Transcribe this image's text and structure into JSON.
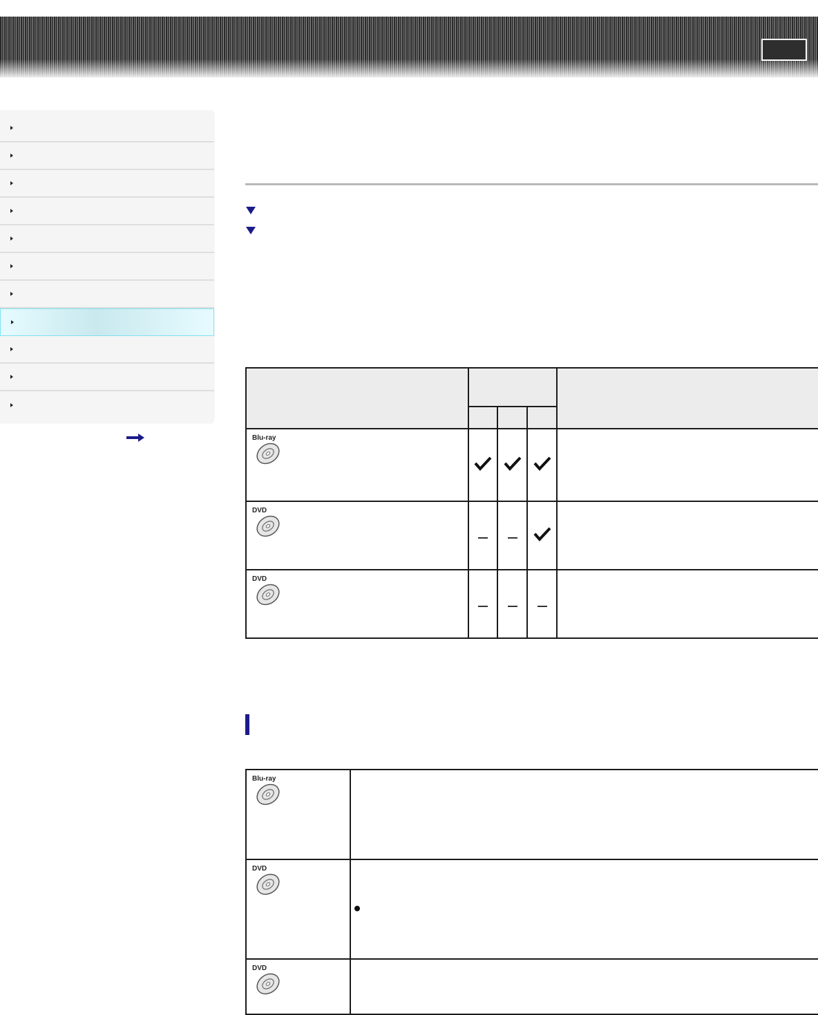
{
  "header": {
    "brand_box": ""
  },
  "sidebar": {
    "items": [
      {
        "label": "",
        "active": false
      },
      {
        "label": "",
        "active": false
      },
      {
        "label": "",
        "active": false
      },
      {
        "label": "",
        "active": false
      },
      {
        "label": "",
        "active": false
      },
      {
        "label": "",
        "active": false
      },
      {
        "label": "",
        "active": false
      },
      {
        "label": "",
        "active": true
      },
      {
        "label": "",
        "active": false
      },
      {
        "label": "",
        "active": false
      },
      {
        "label": "",
        "active": false
      }
    ],
    "more_icon": "right-arrow-icon"
  },
  "main": {
    "anchor_links": [
      {
        "icon": "down-triangle-icon",
        "label": ""
      },
      {
        "icon": "down-triangle-icon",
        "label": ""
      }
    ]
  },
  "compat_table": {
    "rows": [
      {
        "disc_label": "Blu-ray",
        "marks": [
          "check",
          "check",
          "check"
        ]
      },
      {
        "disc_label": "DVD",
        "marks": [
          "dash",
          "dash",
          "check"
        ]
      },
      {
        "disc_label": "DVD",
        "marks": [
          "dash",
          "dash",
          "dash"
        ]
      }
    ]
  },
  "types_table": {
    "rows": [
      {
        "disc_label": "Blu-ray"
      },
      {
        "disc_label": "DVD"
      },
      {
        "disc_label": "DVD"
      }
    ]
  },
  "colors": {
    "accent": "#1b1b8a",
    "nav_active": "#c9e9ee",
    "table_border": "#1a1a1a"
  }
}
